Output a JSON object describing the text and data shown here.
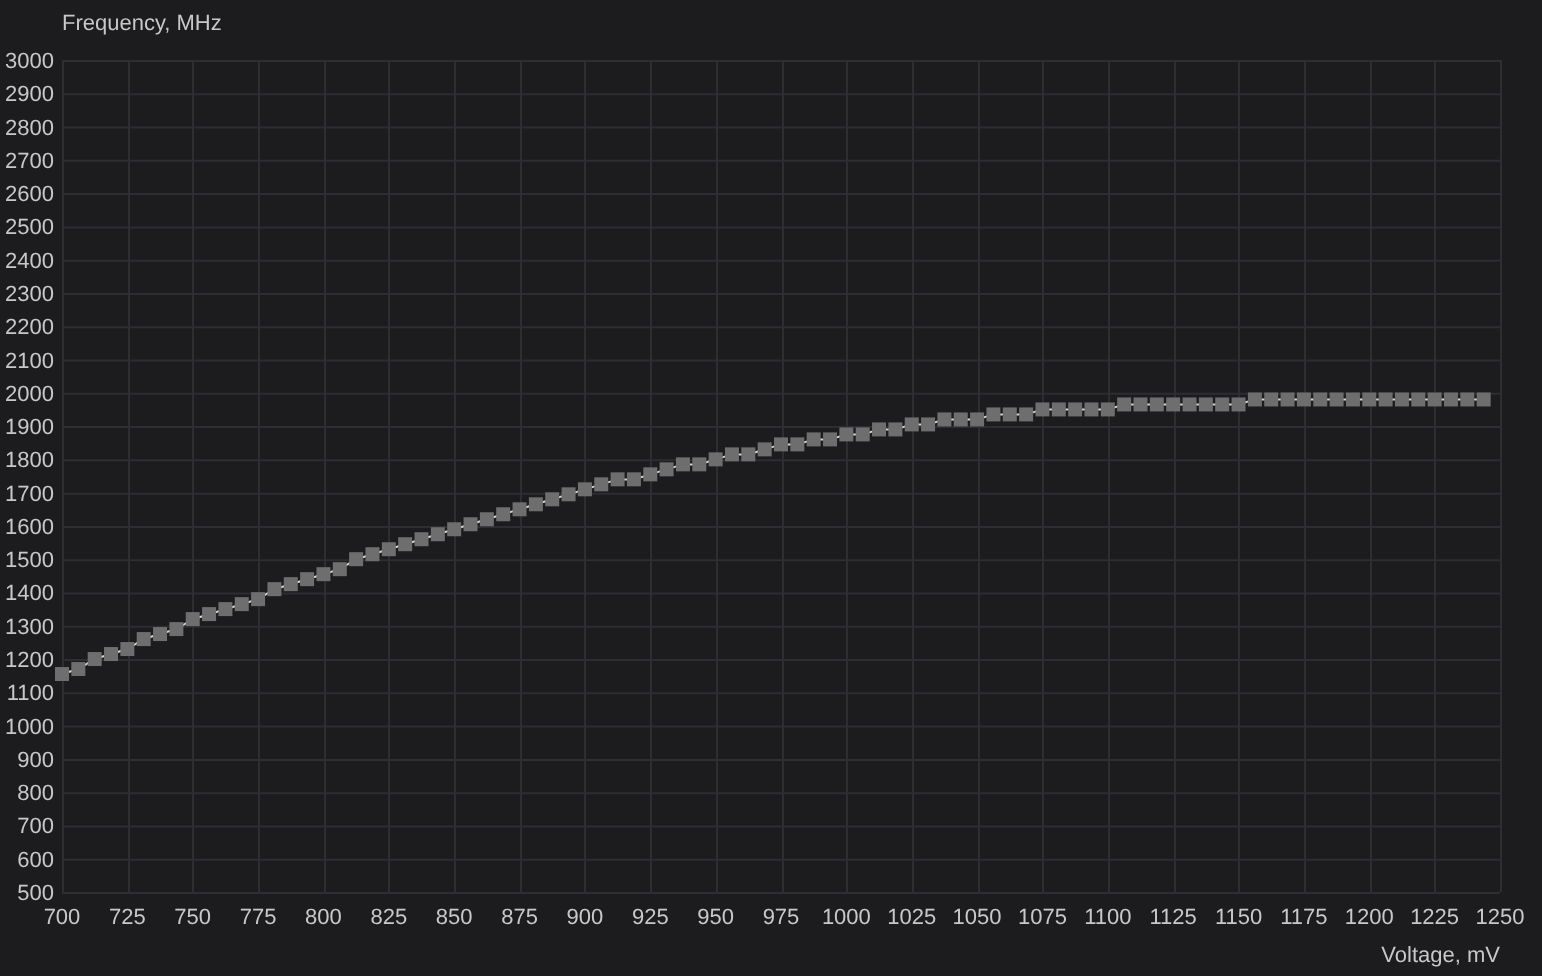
{
  "chart_data": {
    "type": "line",
    "xlabel": "Voltage, mV",
    "ylabel": "Frequency, MHz",
    "x": [
      700,
      706.25,
      712.5,
      718.75,
      725,
      731.25,
      737.5,
      743.75,
      750,
      756.25,
      762.5,
      768.75,
      775,
      781.25,
      787.5,
      793.75,
      800,
      806.25,
      812.5,
      818.75,
      825,
      831.25,
      837.5,
      843.75,
      850,
      856.25,
      862.5,
      868.75,
      875,
      881.25,
      887.5,
      893.75,
      900,
      906.25,
      912.5,
      918.75,
      925,
      931.25,
      937.5,
      943.75,
      950,
      956.25,
      962.5,
      968.75,
      975,
      981.25,
      987.5,
      993.75,
      1000,
      1006.25,
      1012.5,
      1018.75,
      1025,
      1031.25,
      1037.5,
      1043.75,
      1050,
      1056.25,
      1062.5,
      1068.75,
      1075,
      1081.25,
      1087.5,
      1093.75,
      1100,
      1106.25,
      1112.5,
      1118.75,
      1125,
      1131.25,
      1137.5,
      1143.75,
      1150,
      1156.25,
      1162.5,
      1168.75,
      1175,
      1181.25,
      1187.5,
      1193.75,
      1200,
      1206.25,
      1212.5,
      1218.75,
      1225,
      1231.25,
      1237.5,
      1243.75
    ],
    "grid": true,
    "series": [
      {
        "color": "#6e6e6e",
        "marker": "square",
        "values": [
          1155,
          1170,
          1200,
          1215,
          1230,
          1260,
          1275,
          1290,
          1320,
          1335,
          1350,
          1365,
          1380,
          1410,
          1425,
          1440,
          1455,
          1470,
          1500,
          1515,
          1530,
          1545,
          1560,
          1575,
          1590,
          1605,
          1620,
          1635,
          1650,
          1665,
          1680,
          1695,
          1710,
          1725,
          1740,
          1740,
          1755,
          1770,
          1785,
          1785,
          1800,
          1815,
          1815,
          1830,
          1845,
          1845,
          1860,
          1860,
          1875,
          1875,
          1890,
          1890,
          1905,
          1905,
          1920,
          1920,
          1920,
          1935,
          1935,
          1935,
          1950,
          1950,
          1950,
          1950,
          1950,
          1965,
          1965,
          1965,
          1965,
          1965,
          1965,
          1965,
          1965,
          1980,
          1980,
          1980,
          1980,
          1980,
          1980,
          1980,
          1980,
          1980,
          1980,
          1980,
          1980,
          1980,
          1980,
          1980
        ]
      }
    ],
    "xlim": [
      700,
      1250
    ],
    "ylim": [
      500,
      3000
    ],
    "xticks": [
      700,
      725,
      750,
      775,
      800,
      825,
      850,
      875,
      900,
      925,
      950,
      975,
      1000,
      1025,
      1050,
      1075,
      1100,
      1125,
      1150,
      1175,
      1200,
      1225,
      1250
    ],
    "yticks": [
      500,
      600,
      700,
      800,
      900,
      1000,
      1100,
      1200,
      1300,
      1400,
      1500,
      1600,
      1700,
      1800,
      1900,
      2000,
      2100,
      2200,
      2300,
      2400,
      2500,
      2600,
      2700,
      2800,
      2900,
      3000
    ]
  }
}
